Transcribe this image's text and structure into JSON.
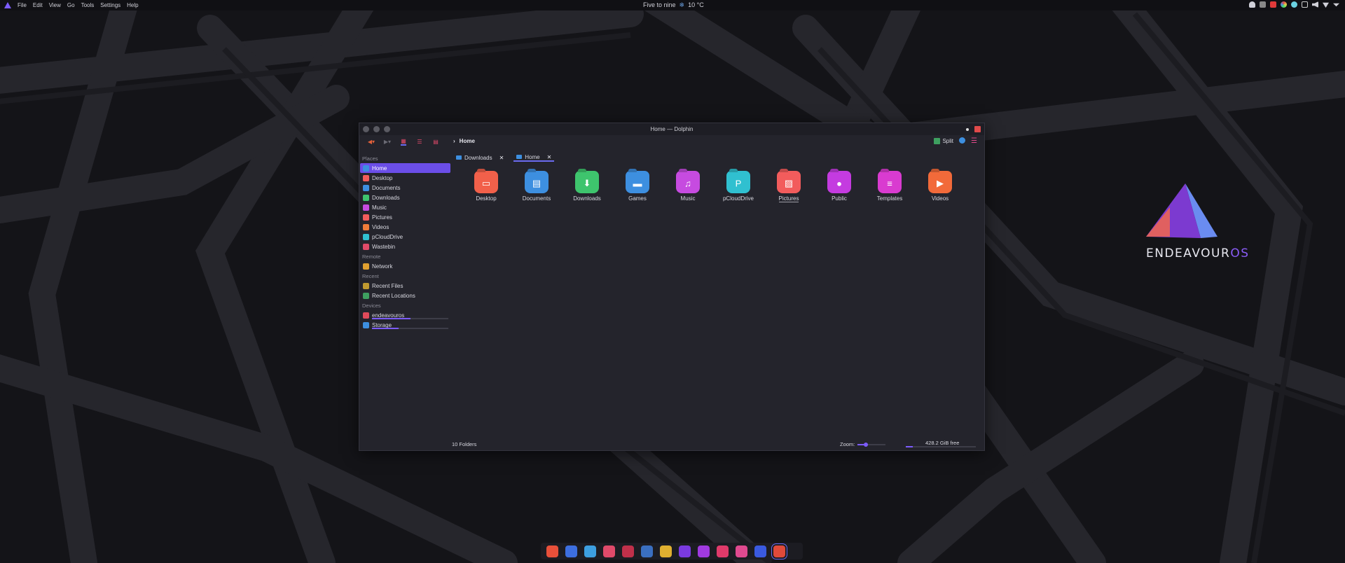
{
  "topbar": {
    "menu": [
      "File",
      "Edit",
      "View",
      "Go",
      "Tools",
      "Settings",
      "Help"
    ],
    "clock_text": "Five to nine",
    "weather": "10 °C"
  },
  "desktop": {
    "logo_text_main": "ENDEAVOUR",
    "logo_text_accent": "OS"
  },
  "window": {
    "title": "Home — Dolphin",
    "breadcrumb": "Home",
    "split_label": "Split"
  },
  "sidebar": {
    "places_heading": "Places",
    "places": [
      {
        "label": "Home",
        "icon": "home-icon",
        "color": "#3d8fe0"
      },
      {
        "label": "Desktop",
        "icon": "desktop-folder-icon",
        "color": "#f25c5c"
      },
      {
        "label": "Documents",
        "icon": "documents-folder-icon",
        "color": "#3d8fe0"
      },
      {
        "label": "Downloads",
        "icon": "downloads-icon",
        "color": "#3ec46d"
      },
      {
        "label": "Music",
        "icon": "music-folder-icon",
        "color": "#c64be0"
      },
      {
        "label": "Pictures",
        "icon": "pictures-folder-icon",
        "color": "#f25c5c"
      },
      {
        "label": "Videos",
        "icon": "videos-folder-icon",
        "color": "#f07c3a"
      },
      {
        "label": "pCloudDrive",
        "icon": "pcloud-icon",
        "color": "#30c0d0"
      },
      {
        "label": "Wastebin",
        "icon": "trash-icon",
        "color": "#e04a68"
      }
    ],
    "remote_heading": "Remote",
    "remote": [
      {
        "label": "Network",
        "icon": "network-icon",
        "color": "#e0a030"
      }
    ],
    "recent_heading": "Recent",
    "recent": [
      {
        "label": "Recent Files",
        "icon": "recent-files-icon",
        "color": "#c09a30"
      },
      {
        "label": "Recent Locations",
        "icon": "recent-locations-icon",
        "color": "#3ea060"
      }
    ],
    "devices_heading": "Devices",
    "devices": [
      {
        "label": "endeavouros",
        "icon": "drive-icon",
        "color": "#e04a5a",
        "usage": 0.5
      },
      {
        "label": "Storage",
        "icon": "storage-icon",
        "color": "#3d8fe0",
        "usage": 0.35
      }
    ]
  },
  "tabs": [
    {
      "label": "Downloads",
      "active": false
    },
    {
      "label": "Home",
      "active": true
    }
  ],
  "folders": [
    {
      "label": "Desktop",
      "icon": "desktop-folder-icon",
      "color": "#f2604a",
      "glyph": "▭"
    },
    {
      "label": "Documents",
      "icon": "documents-folder-icon",
      "color": "#3d8fe0",
      "glyph": "▤"
    },
    {
      "label": "Downloads",
      "icon": "downloads-folder-icon",
      "color": "#3ec46d",
      "glyph": "⬇"
    },
    {
      "label": "Games",
      "icon": "games-folder-icon",
      "color": "#3d8fe0",
      "glyph": "▬"
    },
    {
      "label": "Music",
      "icon": "music-folder-icon",
      "color": "#c64be0",
      "glyph": "♫"
    },
    {
      "label": "pCloudDrive",
      "icon": "pcloud-folder-icon",
      "color": "#30c0d0",
      "glyph": "P"
    },
    {
      "label": "Pictures",
      "icon": "pictures-folder-icon",
      "color": "#f25c5c",
      "glyph": "▨"
    },
    {
      "label": "Public",
      "icon": "public-folder-icon",
      "color": "#c43be0",
      "glyph": "●"
    },
    {
      "label": "Templates",
      "icon": "templates-folder-icon",
      "color": "#d93bd0",
      "glyph": "≡"
    },
    {
      "label": "Videos",
      "icon": "videos-folder-icon",
      "color": "#f26a3a",
      "glyph": "▶"
    }
  ],
  "status": {
    "count": "10 Folders",
    "zoom_label": "Zoom:",
    "zoom_level": 0.3,
    "free_space": "428.2 GiB free",
    "disk_used": 0.1
  },
  "dock": [
    {
      "name": "firefox-icon",
      "color": "#e8503a"
    },
    {
      "name": "mail-icon",
      "color": "#3d6fe0"
    },
    {
      "name": "telegram-icon",
      "color": "#3d9fe0"
    },
    {
      "name": "text-editor-icon",
      "color": "#e04a6a"
    },
    {
      "name": "raspberry-icon",
      "color": "#c0304a"
    },
    {
      "name": "vpn-icon",
      "color": "#3a6fc0"
    },
    {
      "name": "security-icon",
      "color": "#e0b030"
    },
    {
      "name": "tasks-icon",
      "color": "#7a3ae0"
    },
    {
      "name": "media-icon",
      "color": "#a03ae0"
    },
    {
      "name": "video-app-icon",
      "color": "#e03a6a"
    },
    {
      "name": "circle-app-icon",
      "color": "#e04a90"
    },
    {
      "name": "network-app-icon",
      "color": "#3a5ae0"
    },
    {
      "name": "dolphin-icon",
      "color": "#e04a3a"
    }
  ]
}
